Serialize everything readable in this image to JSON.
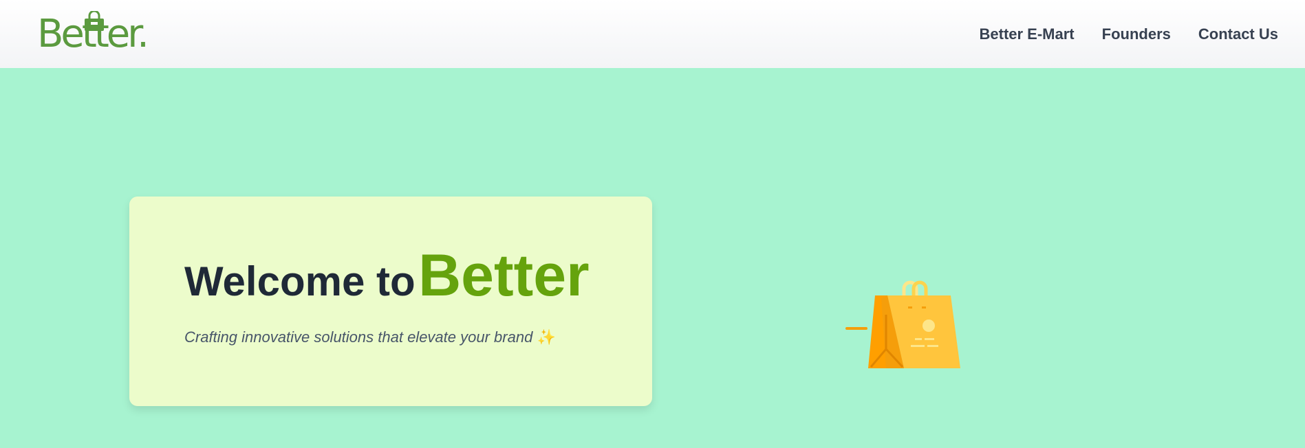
{
  "brand": {
    "logo_text": "Better.",
    "logo_color": "#5b9a3f"
  },
  "nav": {
    "items": [
      {
        "label": "Better E-Mart"
      },
      {
        "label": "Founders"
      },
      {
        "label": "Contact Us"
      }
    ]
  },
  "hero": {
    "headline_lead": "Welcome to",
    "headline_brand": "Better",
    "tagline": "Crafting innovative solutions that elevate your brand",
    "tagline_emoji": "✨",
    "illustration_icon": "shopping-bag-icon"
  },
  "colors": {
    "page_background": "#a7f3d0",
    "card_background": "#ecfccb",
    "brand_green": "#65a30d",
    "heading_dark": "#1f2937",
    "bag_orange": "#ff9f00",
    "bag_yellow": "#ffc53d"
  }
}
